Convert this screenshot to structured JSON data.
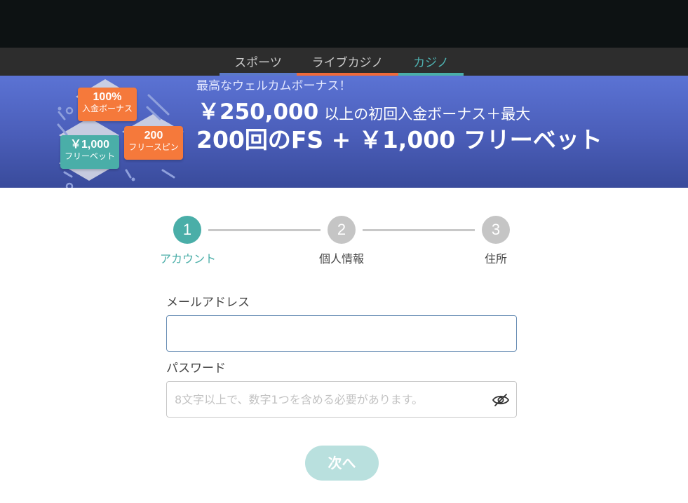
{
  "nav": {
    "tabs": [
      {
        "label": "スポーツ",
        "color": "#5b79c9"
      },
      {
        "label": "ライブカジノ",
        "color": "#ef6a3a"
      },
      {
        "label": "カジノ",
        "color": "#4aaea8"
      }
    ],
    "active_tab": "カジノ"
  },
  "banner": {
    "subtitle": "最高なウェルカムボーナス！",
    "amount": "￥250,000",
    "line1_rest": "以上の初回入金ボーナス＋最大",
    "line2": "200回のFS + ￥1,000 フリーベット",
    "badges": {
      "percent": {
        "big": "100%",
        "small": "入金ボーナス"
      },
      "spins": {
        "big": "200",
        "small": "フリースピン"
      },
      "freebet": {
        "big": "￥1,000",
        "small": "フリーベット"
      }
    }
  },
  "steps": [
    {
      "number": "1",
      "label": "アカウント",
      "state": "active"
    },
    {
      "number": "2",
      "label": "個人情報",
      "state": "inactive"
    },
    {
      "number": "3",
      "label": "住所",
      "state": "inactive"
    }
  ],
  "form": {
    "email": {
      "label": "メールアドレス",
      "value": "",
      "placeholder": ""
    },
    "password": {
      "label": "パスワード",
      "value": "",
      "placeholder": "8文字以上で、数字1つを含める必要があります。",
      "toggle_icon": "eye-slash-icon"
    },
    "next_label": "次へ"
  },
  "colors": {
    "accent": "#4aaea8",
    "button_disabled": "#b9e0de",
    "banner_top": "#5b73d4",
    "banner_bottom": "#394b9b"
  }
}
